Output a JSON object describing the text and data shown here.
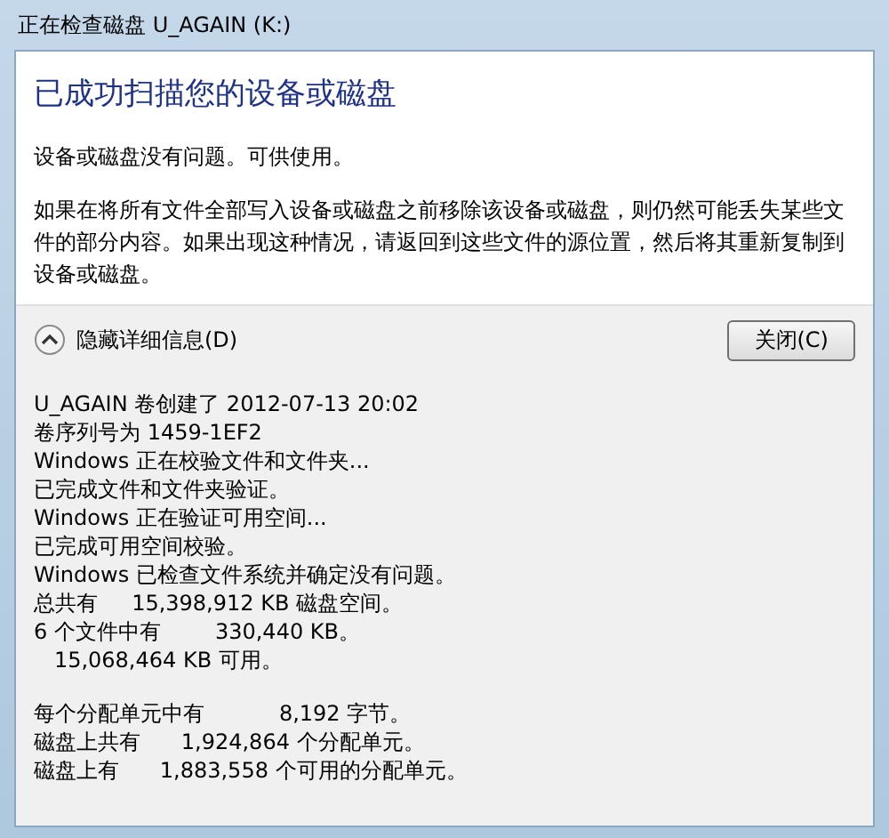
{
  "window": {
    "title": "正在检查磁盘 U_AGAIN (K:)"
  },
  "heading": "已成功扫描您的设备或磁盘",
  "paragraphs": [
    "设备或磁盘没有问题。可供使用。",
    "如果在将所有文件全部写入设备或磁盘之前移除该设备或磁盘，则仍然可能丢失某些文件的部分内容。如果出现这种情况，请返回到这些文件的源位置，然后将其重新复制到设备或磁盘。"
  ],
  "details_toggle": {
    "label": "隐藏详细信息(D)",
    "expanded": true
  },
  "close_button": "关闭(C)",
  "details": [
    [
      "U_AGAIN 卷创建了 2012-07-13 20:02",
      "卷序列号为 1459-1EF2",
      "Windows 正在校验文件和文件夹...",
      "已完成文件和文件夹验证。",
      "Windows 正在验证可用空间...",
      "已完成可用空间校验。",
      "Windows 已检查文件系统并确定没有问题。",
      "总共有     15,398,912 KB 磁盘空间。",
      "6 个文件中有        330,440 KB。",
      "   15,068,464 KB 可用。"
    ],
    [
      "每个分配单元中有           8,192 字节。",
      "磁盘上共有      1,924,864 个分配单元。",
      "磁盘上有      1,883,558 个可用的分配单元。"
    ]
  ]
}
